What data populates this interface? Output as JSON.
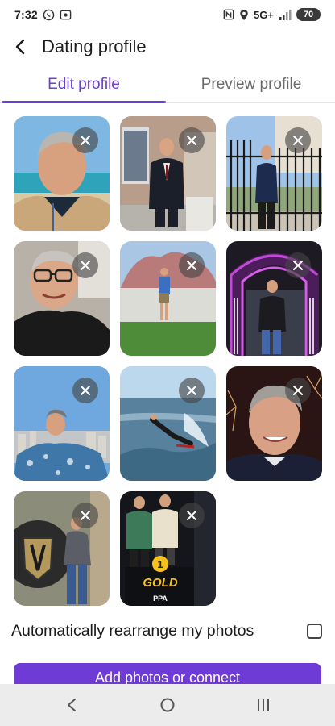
{
  "status_bar": {
    "time": "7:32",
    "network": "5G+",
    "battery": "70",
    "icons": [
      "whatsapp-icon",
      "screen-record-icon",
      "nfc-icon",
      "location-icon",
      "signal-icon",
      "battery-icon"
    ]
  },
  "header": {
    "title": "Dating profile",
    "back_icon": "back-arrow-icon"
  },
  "tabs": [
    {
      "label": "Edit profile",
      "active": true
    },
    {
      "label": "Preview profile",
      "active": false
    }
  ],
  "photos": [
    {
      "slot": 1,
      "description_icon": "photo",
      "removable": true
    },
    {
      "slot": 2,
      "description_icon": "photo",
      "removable": true
    },
    {
      "slot": 3,
      "description_icon": "photo",
      "removable": true
    },
    {
      "slot": 4,
      "description_icon": "photo",
      "removable": true
    },
    {
      "slot": 5,
      "description_icon": "photo",
      "removable": true
    },
    {
      "slot": 6,
      "description_icon": "photo",
      "removable": true
    },
    {
      "slot": 7,
      "description_icon": "photo",
      "removable": true
    },
    {
      "slot": 8,
      "description_icon": "photo",
      "removable": true
    },
    {
      "slot": 9,
      "description_icon": "photo",
      "removable": true
    },
    {
      "slot": 10,
      "description_icon": "photo",
      "removable": true
    },
    {
      "slot": 11,
      "description_icon": "photo",
      "removable": true
    }
  ],
  "photo_text": {
    "medal_number": "1",
    "gold_label": "GOLD",
    "ppa_label": "PPA"
  },
  "settings": {
    "auto_rearrange_label": "Automatically rearrange my photos",
    "auto_rearrange_checked": false
  },
  "add_button": {
    "label": "Add photos or connect"
  },
  "nav": {
    "back_icon": "nav-back-icon",
    "home_icon": "nav-home-icon",
    "recents_icon": "nav-recents-icon"
  },
  "colors": {
    "accent": "#6b3fcf",
    "button": "#6f3bd6",
    "navbar": "#ececec"
  }
}
